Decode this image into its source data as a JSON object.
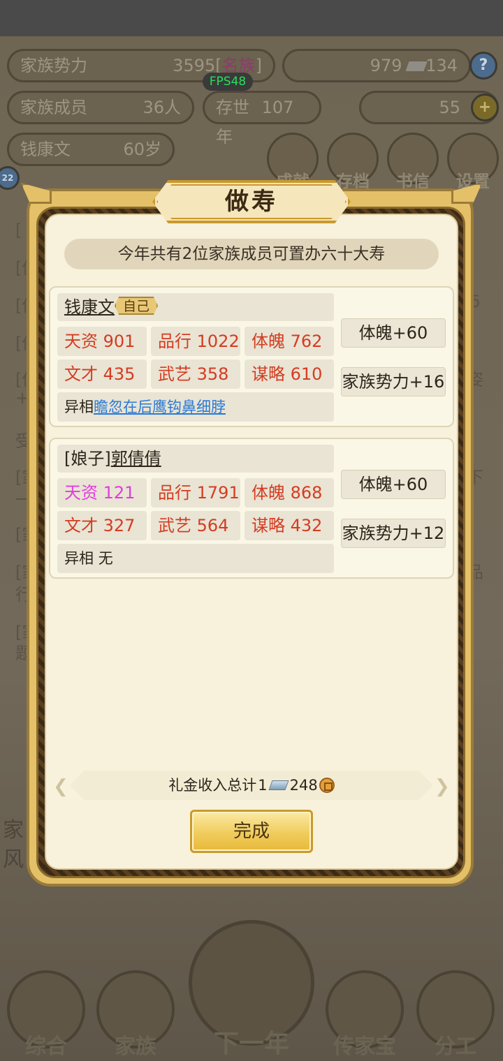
{
  "top": {
    "clan_power_label": "家族势力",
    "clan_power_value": "3595[",
    "clan_power_rank": "名族",
    "clan_power_close": "]",
    "silver": "979",
    "coins": "134",
    "members_label": "家族成员",
    "members_value": "36人",
    "generations_label": "存世",
    "generations_value": "107年",
    "gold": "55",
    "leader_name": "钱康文",
    "leader_age": "60岁",
    "fps": "FPS48",
    "side_badge": "22"
  },
  "menu": {
    "achievements": "成就",
    "save": "存档",
    "letters": "书信",
    "settings": "设置"
  },
  "background_tags": [
    "[",
    "[传",
    "[传",
    "[传",
    "[传",
    "+4",
    "受",
    "[家",
    "一",
    "[家",
    "[家",
    "行",
    "[家",
    "题",
    "6",
    "姿",
    "下",
    "品",
    "家",
    "风"
  ],
  "nav": {
    "overview": "综合",
    "family": "家族",
    "next_year": "下一年",
    "heirloom": "传家宝",
    "assign": "分工"
  },
  "dialog": {
    "title": "做寿",
    "banner": "今年共有2位家族成员可置办六十大寿",
    "members": [
      {
        "name": "钱康文",
        "tag": "自己",
        "stats": [
          {
            "label": "天资",
            "value": "901"
          },
          {
            "label": "品行",
            "value": "1022"
          },
          {
            "label": "体魄",
            "value": "762"
          },
          {
            "label": "文才",
            "value": "435"
          },
          {
            "label": "武艺",
            "value": "358"
          },
          {
            "label": "谋略",
            "value": "610"
          }
        ],
        "trait_label": "异相",
        "trait_value": "瞻忽在后鹰钩鼻细脖",
        "bonus_physique": "体魄+60",
        "bonus_power": "家族势力+16"
      },
      {
        "prefix": "[娘子]",
        "name": "郭倩倩",
        "stats": [
          {
            "label": "天资",
            "value": "121"
          },
          {
            "label": "品行",
            "value": "1791"
          },
          {
            "label": "体魄",
            "value": "868"
          },
          {
            "label": "文才",
            "value": "327"
          },
          {
            "label": "武艺",
            "value": "564"
          },
          {
            "label": "谋略",
            "value": "432"
          }
        ],
        "trait_label": "异相",
        "trait_value": "无",
        "bonus_physique": "体魄+60",
        "bonus_power": "家族势力+12"
      }
    ],
    "income_label": "礼金收入总计",
    "income_silver": "1",
    "income_coins": "248",
    "done_button": "完成"
  }
}
